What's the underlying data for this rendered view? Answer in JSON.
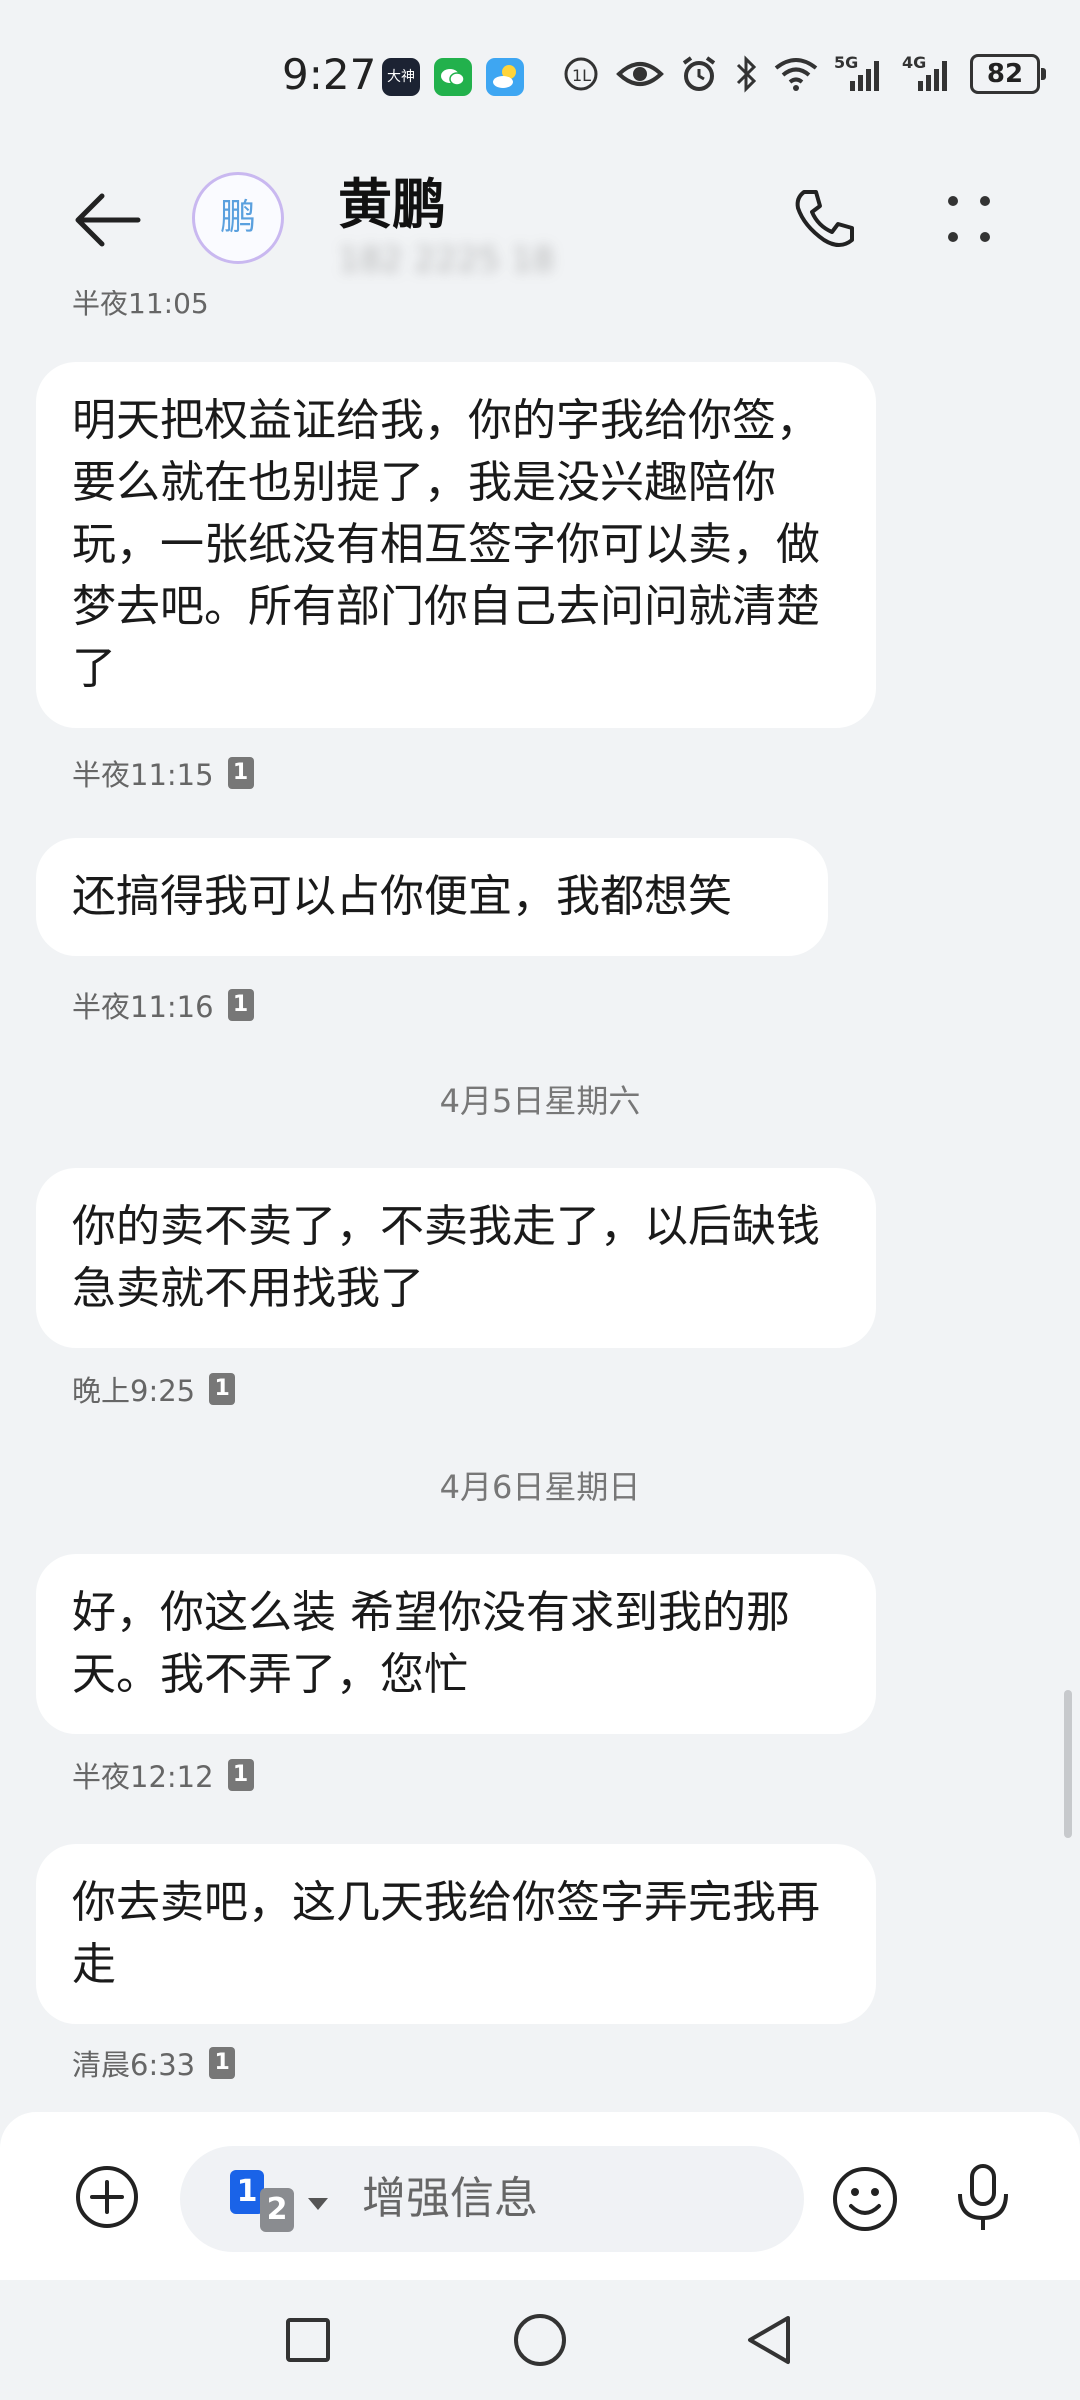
{
  "status_bar": {
    "time": "9:27",
    "app_badge_label": "大神",
    "network_1": "5G",
    "network_2": "4G",
    "battery": "82"
  },
  "header": {
    "avatar_char": "鹏",
    "contact_name": "黄鹏",
    "contact_number": "182 2225 18"
  },
  "chat": {
    "partial_time": "半夜11:05",
    "messages": [
      {
        "text": "明天把权益证给我，你的字我给你签，要么就在也别提了，我是没兴趣陪你玩，一张纸没有相互签字你可以卖，做梦去吧。所有部门你自己去问问就清楚了",
        "time": "半夜11:15",
        "sim": "1"
      },
      {
        "text": "还搞得我可以占你便宜，我都想笑",
        "time": "半夜11:16",
        "sim": "1"
      },
      {
        "text": "你的卖不卖了，不卖我走了，以后缺钱急卖就不用找我了",
        "time": "晚上9:25",
        "sim": "1"
      },
      {
        "text": "好，你这么装 希望你没有求到我的那天。我不弄了，您忙",
        "time": "半夜12:12",
        "sim": "1"
      },
      {
        "text": "你去卖吧，这几天我给你签字弄完我再走",
        "time": "清晨6:33",
        "sim": "1"
      }
    ],
    "date_separators": [
      "4月5日星期六",
      "4月6日星期日"
    ]
  },
  "composer": {
    "sim_primary": "1",
    "sim_secondary": "2",
    "placeholder": "增强信息"
  },
  "colors": {
    "background": "#f1f3f5",
    "bubble": "#ffffff",
    "sim_active": "#1a63e8",
    "avatar_border": "#c9b8f0",
    "avatar_text": "#5aa0de"
  },
  "icons": [
    "back-arrow-icon",
    "phone-icon",
    "more-icon",
    "add-icon",
    "emoji-icon",
    "mic-icon",
    "wifi-icon",
    "bluetooth-icon",
    "alarm-icon",
    "eye-icon"
  ]
}
